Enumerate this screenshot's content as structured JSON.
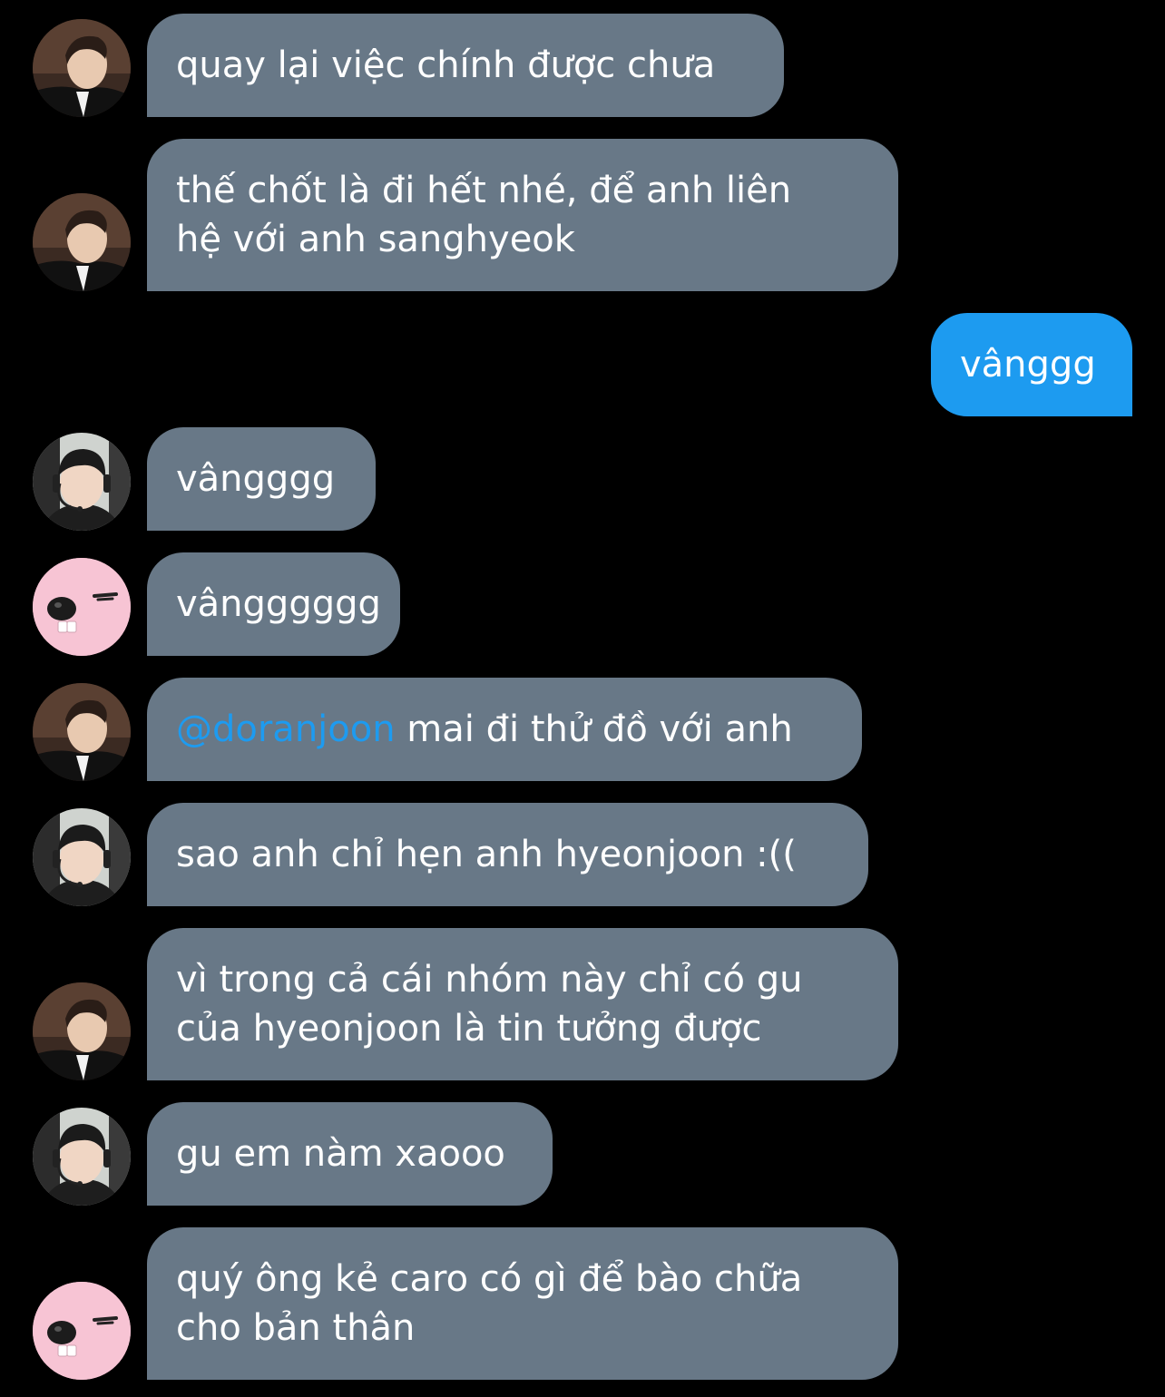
{
  "colors": {
    "background": "#000000",
    "incoming_bubble": "#687887",
    "outgoing_bubble": "#1d9bf0",
    "mention": "#1d9bf0",
    "text": "#ffffff"
  },
  "messages": [
    {
      "sender": "man-in-suit",
      "avatar_icon": "man-in-suit-avatar-icon",
      "text": "quay lại việc chính được chưa"
    },
    {
      "sender": "man-in-suit",
      "avatar_icon": "man-in-suit-avatar-icon",
      "text_line1": "thế chốt là đi hết nhé, để anh liên",
      "text_line2": "hệ với anh sanghyeok"
    },
    {
      "sender": "me",
      "text": "vânggg"
    },
    {
      "sender": "gamer-headset",
      "avatar_icon": "gamer-headset-avatar-icon",
      "text": "vângggg"
    },
    {
      "sender": "pink-beaver",
      "avatar_icon": "pink-beaver-avatar-icon",
      "text": "vângggggg"
    },
    {
      "sender": "man-in-suit",
      "avatar_icon": "man-in-suit-avatar-icon",
      "mention": "@doranjoon",
      "text": " mai đi thử đồ với anh"
    },
    {
      "sender": "gamer-headset",
      "avatar_icon": "gamer-headset-avatar-icon",
      "text": "sao anh chỉ hẹn anh hyeonjoon :(("
    },
    {
      "sender": "man-in-suit",
      "avatar_icon": "man-in-suit-avatar-icon",
      "text_line1": "vì trong cả cái nhóm này chỉ có gu",
      "text_line2": "của hyeonjoon là tin tưởng được"
    },
    {
      "sender": "gamer-headset",
      "avatar_icon": "gamer-headset-avatar-icon",
      "text": "gu em nàm xaooo"
    },
    {
      "sender": "pink-beaver",
      "avatar_icon": "pink-beaver-avatar-icon",
      "text_line1": "quý ông kẻ caro có gì để bào chữa",
      "text_line2": "cho bản thân"
    }
  ]
}
